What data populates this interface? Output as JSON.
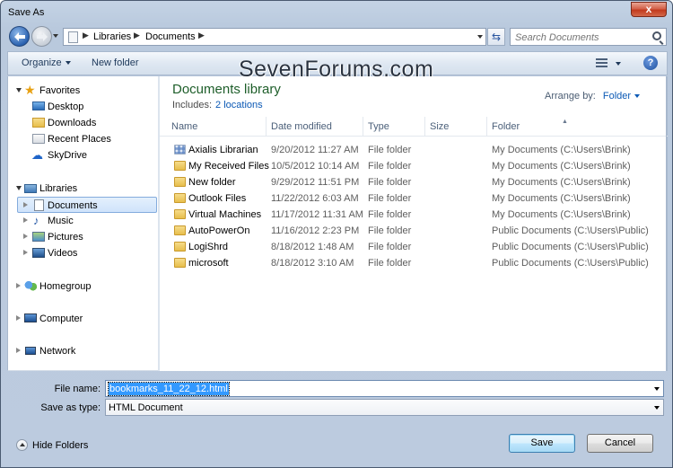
{
  "window": {
    "title": "Save As",
    "close_label": "x"
  },
  "address": {
    "crumbs": [
      "Libraries",
      "Documents"
    ],
    "search_placeholder": "Search Documents"
  },
  "toolbar": {
    "organize": "Organize",
    "new_folder": "New folder",
    "help": "?"
  },
  "watermark": "SevenForums.com",
  "nav": {
    "favorites": "Favorites",
    "desktop": "Desktop",
    "downloads": "Downloads",
    "recent_places": "Recent Places",
    "skydrive": "SkyDrive",
    "libraries": "Libraries",
    "documents": "Documents",
    "music": "Music",
    "pictures": "Pictures",
    "videos": "Videos",
    "homegroup": "Homegroup",
    "computer": "Computer",
    "network": "Network"
  },
  "library": {
    "title": "Documents library",
    "includes_label": "Includes:",
    "includes_link": "2 locations",
    "arrange_label": "Arrange by:",
    "arrange_value": "Folder"
  },
  "columns": {
    "name": "Name",
    "date": "Date modified",
    "type": "Type",
    "size": "Size",
    "folder": "Folder"
  },
  "files": [
    {
      "name": "Axialis Librarian",
      "date": "9/20/2012 11:27 AM",
      "type": "File folder",
      "folder": "My Documents (C:\\Users\\Brink)"
    },
    {
      "name": "My Received Files",
      "date": "10/5/2012 10:14 AM",
      "type": "File folder",
      "folder": "My Documents (C:\\Users\\Brink)"
    },
    {
      "name": "New folder",
      "date": "9/29/2012 11:51 PM",
      "type": "File folder",
      "folder": "My Documents (C:\\Users\\Brink)"
    },
    {
      "name": "Outlook Files",
      "date": "11/22/2012 6:03 AM",
      "type": "File folder",
      "folder": "My Documents (C:\\Users\\Brink)"
    },
    {
      "name": "Virtual Machines",
      "date": "11/17/2012 11:31 AM",
      "type": "File folder",
      "folder": "My Documents (C:\\Users\\Brink)"
    },
    {
      "name": "AutoPowerOn",
      "date": "11/16/2012 2:23 PM",
      "type": "File folder",
      "folder": "Public Documents (C:\\Users\\Public)"
    },
    {
      "name": "LogiShrd",
      "date": "8/18/2012 1:48 AM",
      "type": "File folder",
      "folder": "Public Documents (C:\\Users\\Public)"
    },
    {
      "name": "microsoft",
      "date": "8/18/2012 3:10 AM",
      "type": "File folder",
      "folder": "Public Documents (C:\\Users\\Public)"
    }
  ],
  "form": {
    "filename_label": "File name:",
    "filename_value": "bookmarks_11_22_12.html",
    "savetype_label": "Save as type:",
    "savetype_value": "HTML Document"
  },
  "footer": {
    "hide_folders": "Hide Folders",
    "save": "Save",
    "cancel": "Cancel"
  }
}
